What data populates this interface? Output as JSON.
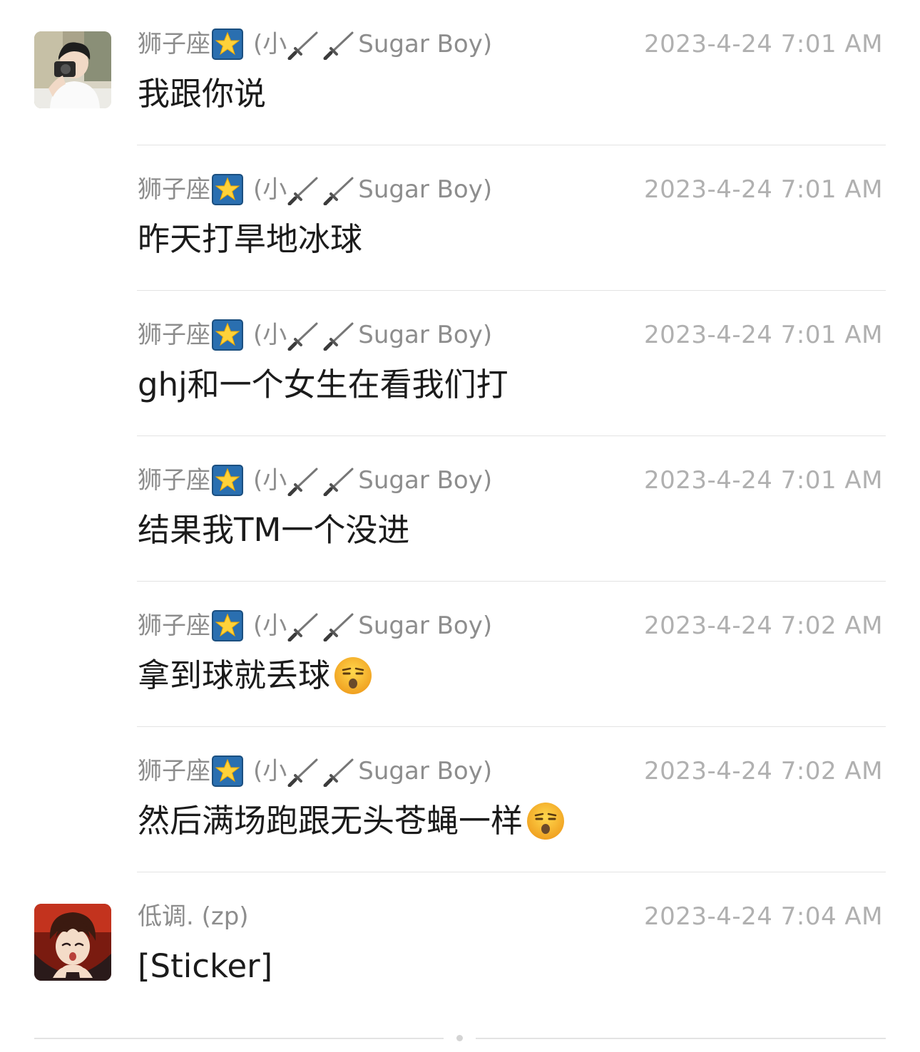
{
  "messages": [
    {
      "sender_name": "狮子座",
      "sender_open": "(小",
      "sender_tail": "Sugar Boy)",
      "timestamp": "2023-4-24 7:01 AM",
      "text": "我跟你说",
      "show_avatar": true,
      "avatar_icon": "photographer-avatar"
    },
    {
      "sender_name": "狮子座",
      "sender_open": "(小",
      "sender_tail": "Sugar Boy)",
      "timestamp": "2023-4-24 7:01 AM",
      "text": "昨天打旱地冰球",
      "show_avatar": false
    },
    {
      "sender_name": "狮子座",
      "sender_open": "(小",
      "sender_tail": "Sugar Boy)",
      "timestamp": "2023-4-24 7:01 AM",
      "text": "ghj和一个女生在看我们打",
      "show_avatar": false
    },
    {
      "sender_name": "狮子座",
      "sender_open": "(小",
      "sender_tail": "Sugar Boy)",
      "timestamp": "2023-4-24 7:01 AM",
      "text": "结果我TM一个没进",
      "show_avatar": false
    },
    {
      "sender_name": "狮子座",
      "sender_open": "(小",
      "sender_tail": "Sugar Boy)",
      "timestamp": "2023-4-24 7:02 AM",
      "text": "拿到球就丢球",
      "emoji": "unamused-face",
      "show_avatar": false
    },
    {
      "sender_name": "狮子座",
      "sender_open": "(小",
      "sender_tail": "Sugar Boy)",
      "timestamp": "2023-4-24 7:02 AM",
      "text": "然后满场跑跟无头苍蝇一样",
      "emoji": "unamused-face",
      "show_avatar": false
    },
    {
      "sender_name": "低调. (zp)",
      "timestamp": "2023-4-24 7:04 AM",
      "text": "[Sticker]",
      "show_avatar": true,
      "avatar_icon": "anime-character-avatar"
    }
  ],
  "colors": {
    "sender": "#8d8d8d",
    "timestamp": "#b0b0b0",
    "message_text": "#1b1b1b",
    "divider": "#e3e3e3",
    "background": "#ffffff"
  },
  "icons": {
    "badge": "star-badge-icon",
    "decoration": "dagger-icon"
  }
}
